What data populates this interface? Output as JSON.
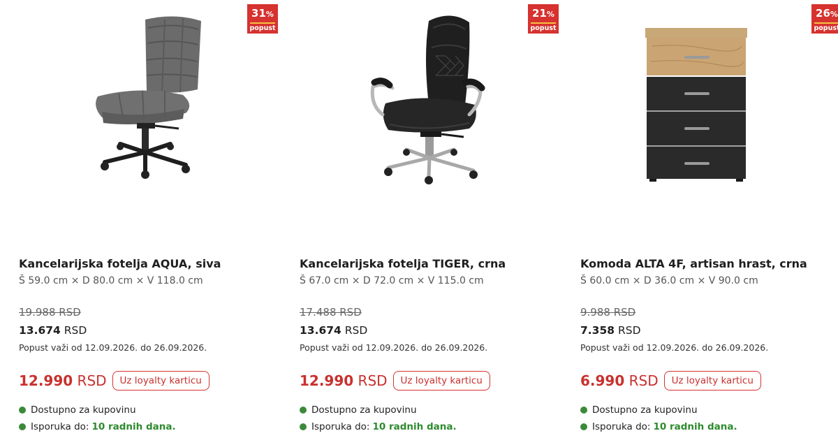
{
  "colors": {
    "discount_red": "#d6322f",
    "badge_bar": "#f5c242",
    "available_green": "#3a8a3a"
  },
  "products": [
    {
      "badge": {
        "percent": "31",
        "percent_sign": "%",
        "label": "popust"
      },
      "image": "grey-office-chair",
      "title": "Kancelarijska fotelja AQUA, siva",
      "dimensions": "Š 59.0 cm × D 80.0 cm × V 118.0 cm",
      "old_price": "19.988 RSD",
      "new_price_amount": "13.674",
      "new_price_currency": "RSD",
      "validity": "Popust važi od 12.09.2026. do 26.09.2026.",
      "loyalty_price_amount": "12.990",
      "loyalty_price_currency": "RSD",
      "loyalty_button": "Uz loyalty karticu",
      "availability": "Dostupno za kupovinu",
      "delivery_label": "Isporuka do:",
      "delivery_days": "10 radnih dana."
    },
    {
      "badge": {
        "percent": "21",
        "percent_sign": "%",
        "label": "popust"
      },
      "image": "black-executive-chair",
      "title": "Kancelarijska fotelja TIGER, crna",
      "dimensions": "Š 67.0 cm × D 72.0 cm × V 115.0 cm",
      "old_price": "17.488 RSD",
      "new_price_amount": "13.674",
      "new_price_currency": "RSD",
      "validity": "Popust važi od 12.09.2026. do 26.09.2026.",
      "loyalty_price_amount": "12.990",
      "loyalty_price_currency": "RSD",
      "loyalty_button": "Uz loyalty karticu",
      "availability": "Dostupno za kupovinu",
      "delivery_label": "Isporuka do:",
      "delivery_days": "10 radnih dana."
    },
    {
      "badge": {
        "percent": "26",
        "percent_sign": "%",
        "label": "popust"
      },
      "image": "chest-of-drawers",
      "title": "Komoda ALTA 4F, artisan hrast, crna",
      "dimensions": "Š 60.0 cm × D 36.0 cm × V 90.0 cm",
      "old_price": "9.988 RSD",
      "new_price_amount": "7.358",
      "new_price_currency": "RSD",
      "validity": "Popust važi od 12.09.2026. do 26.09.2026.",
      "loyalty_price_amount": "6.990",
      "loyalty_price_currency": "RSD",
      "loyalty_button": "Uz loyalty karticu",
      "availability": "Dostupno za kupovinu",
      "delivery_label": "Isporuka do:",
      "delivery_days": "10 radnih dana."
    }
  ]
}
